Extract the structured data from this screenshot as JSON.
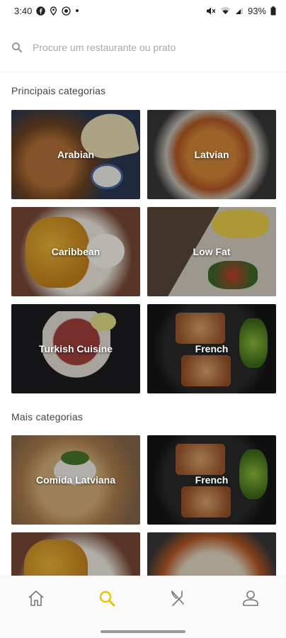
{
  "status": {
    "time": "3:40",
    "battery": "93%"
  },
  "search": {
    "placeholder": "Procure um restaurante ou prato"
  },
  "sections": {
    "main_title": "Principais categorias",
    "more_title": "Mais categorias"
  },
  "main_categories": [
    {
      "label": "Arabian"
    },
    {
      "label": "Latvian"
    },
    {
      "label": "Caribbean"
    },
    {
      "label": "Low Fat"
    },
    {
      "label": "Turkish Cuisine"
    },
    {
      "label": "French"
    }
  ],
  "more_categories": [
    {
      "label": "Comida Latviana"
    },
    {
      "label": "French"
    }
  ],
  "nav": {
    "items": [
      {
        "icon": "home-icon",
        "active": false
      },
      {
        "icon": "search-icon",
        "active": true
      },
      {
        "icon": "fork-knife-icon",
        "active": false
      },
      {
        "icon": "profile-icon",
        "active": false
      }
    ]
  },
  "colors": {
    "accent": "#e8c300",
    "nav_icon": "#777777"
  }
}
